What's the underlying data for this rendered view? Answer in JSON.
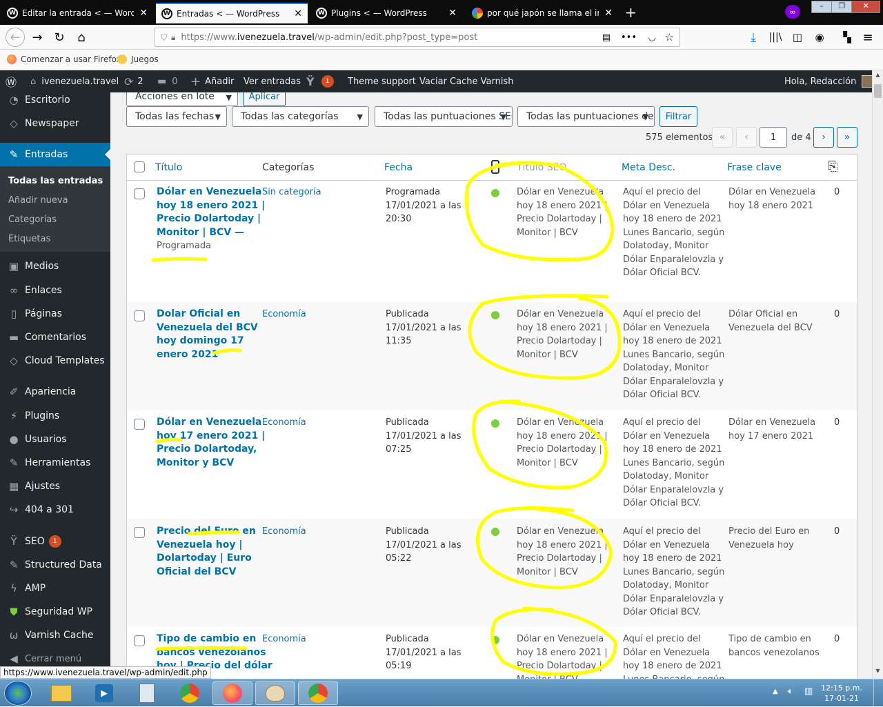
{
  "browser": {
    "tabs": [
      {
        "label": "Editar la entrada < — WordPress",
        "icon": "wordpress-icon"
      },
      {
        "label": "Entradas < — WordPress",
        "icon": "wordpress-icon",
        "active": true
      },
      {
        "label": "Plugins < — WordPress",
        "icon": "wordpress-icon"
      },
      {
        "label": "por qué japón se llama el imperio",
        "icon": "google-icon"
      }
    ],
    "url_prefix": "https://www.",
    "url_host": "ivenezuela.travel",
    "url_path": "/wp-admin/edit.php?post_type=post",
    "bookmarks": [
      "Comenzar a usar Firefox",
      "Juegos"
    ],
    "status_link": "https://www.ivenezuela.travel/wp-admin/edit.php"
  },
  "adminbar": {
    "site": "ivenezuela.travel",
    "updates": "2",
    "comments": "0",
    "add": "Añadir",
    "view": "Ver entradas",
    "yoast_count": "1",
    "theme_support": "Theme support",
    "varnish": "Vaciar Cache Varnish",
    "greeting": "Hola, Redacción"
  },
  "sidebar": {
    "items": [
      {
        "label": "Escritorio",
        "icon": "dashboard-icon"
      },
      {
        "label": "Newspaper",
        "icon": "newspaper-icon"
      },
      {
        "label": "Entradas",
        "icon": "pin-icon",
        "current": true
      },
      {
        "label": "Medios",
        "icon": "media-icon"
      },
      {
        "label": "Enlaces",
        "icon": "link-icon"
      },
      {
        "label": "Páginas",
        "icon": "pages-icon"
      },
      {
        "label": "Comentarios",
        "icon": "comment-icon"
      },
      {
        "label": "Cloud Templates",
        "icon": "cloud-icon"
      },
      {
        "label": "Apariencia",
        "icon": "brush-icon"
      },
      {
        "label": "Plugins",
        "icon": "plugin-icon"
      },
      {
        "label": "Usuarios",
        "icon": "user-icon"
      },
      {
        "label": "Herramientas",
        "icon": "wrench-icon"
      },
      {
        "label": "Ajustes",
        "icon": "settings-icon"
      },
      {
        "label": "404 a 301",
        "icon": "redirect-icon"
      },
      {
        "label": "SEO",
        "icon": "yoast-icon",
        "badge": "1"
      },
      {
        "label": "Structured Data",
        "icon": "pin-icon"
      },
      {
        "label": "AMP",
        "icon": "amp-icon"
      },
      {
        "label": "Seguridad WP",
        "icon": "shield-icon"
      },
      {
        "label": "Varnish Cache",
        "icon": "varnish-icon"
      },
      {
        "label": "Cerrar menú",
        "icon": "collapse-icon"
      }
    ],
    "submenu": [
      "Todas las entradas",
      "Añadir nueva",
      "Categorías",
      "Etiquetas"
    ]
  },
  "filters": {
    "bulk": "Acciones en lote",
    "apply": "Aplicar",
    "dates": "Todas las fechas",
    "categories": "Todas las categorías",
    "seo_scores": "Todas las puntuaciones SEO",
    "readability": "Todas las puntuaciones de",
    "filter": "Filtrar",
    "count": "575 elementos",
    "page": "1",
    "of_pages": "de 4"
  },
  "columns": {
    "title": "Título",
    "categories": "Categorías",
    "date": "Fecha",
    "seo_title": "Título SEO",
    "meta": "Meta Desc.",
    "keyphrase": "Frase clave"
  },
  "rows": [
    {
      "title": [
        "Dólar en Venezuela",
        "hoy 18 enero 2021 |",
        "Precio Dolartoday |",
        "Monitor | BCV —",
        "Programada"
      ],
      "category": "Sin categoría",
      "date": [
        "Programada",
        "17/01/2021 a las",
        "20:30"
      ],
      "seo_title": [
        "Dólar en Venezuela",
        "hoy 18 enero 2021 |",
        "Precio Dolartoday |",
        "Monitor | BCV"
      ],
      "meta": [
        "Aquí el precio del",
        "Dólar en Venezuela",
        "hoy 18 enero de 2021",
        "Lunes Bancario, según",
        "Dolatoday, Monitor",
        "Dólar Enparalelovzla y",
        "Dólar Oficial BCV."
      ],
      "keyphrase": [
        "Dólar en Venezuela",
        "hoy 18 enero 2021"
      ],
      "links": "0"
    },
    {
      "title": [
        "Dolar Oficial en",
        "Venezuela del BCV",
        "hoy domingo 17",
        "enero 2021"
      ],
      "category": "Economía",
      "date": [
        "Publicada",
        "17/01/2021 a las",
        "11:35"
      ],
      "seo_title": [
        "Dólar en Venezuela",
        "hoy 18 enero 2021 |",
        "Precio Dolartoday |",
        "Monitor | BCV"
      ],
      "meta": [
        "Aquí el precio del",
        "Dólar en Venezuela",
        "hoy 18 enero de 2021",
        "Lunes Bancario, según",
        "Dolatoday, Monitor",
        "Dólar Enparalelovzla y",
        "Dólar Oficial BCV."
      ],
      "keyphrase": [
        "Dólar Oficial en",
        "Venezuela del BCV"
      ],
      "links": "0"
    },
    {
      "title": [
        "Dólar en Venezuela",
        "hoy 17 enero 2021 |",
        "Precio Dolartoday,",
        "Monitor y BCV"
      ],
      "category": "Economía",
      "date": [
        "Publicada",
        "17/01/2021 a las",
        "07:25"
      ],
      "seo_title": [
        "Dólar en Venezuela",
        "hoy 18 enero 2021 |",
        "Precio Dolartoday |",
        "Monitor | BCV"
      ],
      "meta": [
        "Aquí el precio del",
        "Dólar en Venezuela",
        "hoy 18 enero de 2021",
        "Lunes Bancario, según",
        "Dolatoday, Monitor",
        "Dólar Enparalelovzla y",
        "Dólar Oficial BCV."
      ],
      "keyphrase": [
        "Dólar en Venezuela",
        "hoy 17 enero 2021"
      ],
      "links": "0"
    },
    {
      "title": [
        "Precio del Euro en",
        "Venezuela hoy |",
        "Dolartoday | Euro",
        "Oficial del BCV"
      ],
      "category": "Economía",
      "date": [
        "Publicada",
        "17/01/2021 a las",
        "05:22"
      ],
      "seo_title": [
        "Dólar en Venezuela",
        "hoy 18 enero 2021 |",
        "Precio Dolartoday |",
        "Monitor | BCV"
      ],
      "meta": [
        "Aquí el precio del",
        "Dólar en Venezuela",
        "hoy 18 enero de 2021",
        "Lunes Bancario, según",
        "Dolatoday, Monitor",
        "Dólar Enparalelovzla y",
        "Dólar Oficial BCV."
      ],
      "keyphrase": [
        "Precio del Euro en",
        "Venezuela hoy"
      ],
      "links": "0"
    },
    {
      "title": [
        "Tipo de cambio en",
        "bancos venezolanos",
        "hoy | Precio del dólar"
      ],
      "category": "Economía",
      "date": [
        "Publicada",
        "17/01/2021 a las",
        "05:19"
      ],
      "seo_title": [
        "Dólar en Venezuela",
        "hoy 18 enero 2021 |",
        "Precio Dolartoday |",
        "Monitor | BCV"
      ],
      "meta": [
        "Aquí el precio del",
        "Dólar en Venezuela",
        "hoy 18 enero de 2021",
        "Lunes Bancario, según"
      ],
      "keyphrase": [
        "Tipo de cambio en",
        "bancos venezolanos"
      ],
      "links": "0"
    }
  ],
  "taskbar": {
    "time": "12:15 p.m.",
    "date": "17-01-21"
  },
  "colors": {
    "admin_dark": "#23282d",
    "wp_blue": "#0073aa",
    "seo_good": "#7ad03a",
    "highlight": "#ffff00"
  }
}
